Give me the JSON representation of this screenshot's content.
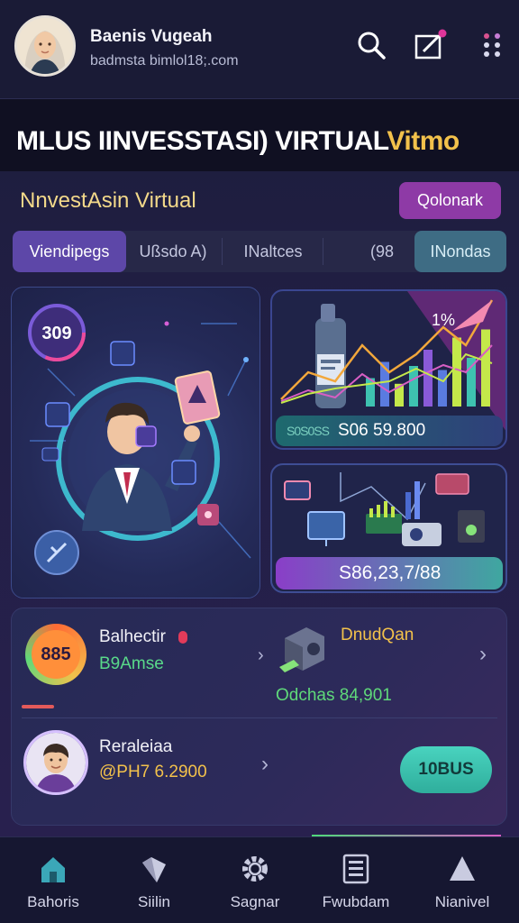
{
  "profile": {
    "name": "Baenis Vugeah",
    "email": "badmsta bimlol18;.com"
  },
  "header_icons": [
    "search-icon",
    "edit-icon",
    "more-icon"
  ],
  "banner": {
    "title": "MLUS IINVESSTASI) VIRTUAL",
    "suffix": "Vitmo"
  },
  "section": {
    "title": "NnvestAsin Virtual",
    "action_label": "Qolonark"
  },
  "tabs": [
    {
      "label": "Viendipegs"
    },
    {
      "label": "Ußsdo A)"
    },
    {
      "label": "INaltces"
    },
    {
      "label": "(98"
    },
    {
      "label": "INondas"
    }
  ],
  "hero": {
    "badge": "309"
  },
  "chart_card": {
    "percent": "1%",
    "value_prefix": "S0S0SS",
    "value": "S06 59.800",
    "bars": [
      0.35,
      0.55,
      0.28,
      0.5,
      0.7,
      0.45,
      0.85,
      0.6,
      0.95
    ]
  },
  "device_card": {
    "value": "S86,23,7/88"
  },
  "rows": [
    {
      "score": "885",
      "title": "Balhectir",
      "subtitle": "B9Amse",
      "right_title": "DnudQan",
      "right_value": "Odchas 84,901"
    },
    {
      "title": "Reraleiaa",
      "subtitle": "@PH7 6.2900",
      "button": "10BUS"
    }
  ],
  "nav": [
    {
      "label": "Bahoris",
      "icon": "home-icon"
    },
    {
      "label": "Siilin",
      "icon": "diamond-icon"
    },
    {
      "label": "Sagnar",
      "icon": "gear-icon"
    },
    {
      "label": "Fwubdam",
      "icon": "list-icon"
    },
    {
      "label": "Nianivel",
      "icon": "triangle-icon"
    }
  ],
  "colors": {
    "accent_purple": "#8e3aa6",
    "teal": "#3ec2b0",
    "gold": "#f2c14b",
    "green_text": "#4fd97a"
  }
}
